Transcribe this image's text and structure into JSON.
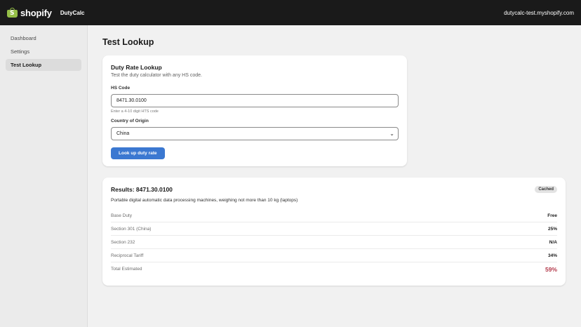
{
  "topbar": {
    "brand": "shopify",
    "app_name": "DutyCalc",
    "store": "dutycalc-test.myshopify.com"
  },
  "sidebar": {
    "items": [
      {
        "label": "Dashboard",
        "active": false
      },
      {
        "label": "Settings",
        "active": false
      },
      {
        "label": "Test Lookup",
        "active": true
      }
    ]
  },
  "page": {
    "title": "Test Lookup"
  },
  "lookup": {
    "title": "Duty Rate Lookup",
    "subtitle": "Test the duty calculator with any HS code.",
    "hs_label": "HS Code",
    "hs_value": "8471.30.0100",
    "hs_help": "Enter a 4-10 digit HTS code",
    "country_label": "Country of Origin",
    "country_value": "China",
    "button_label": "Look up duty rate"
  },
  "results": {
    "title": "Results: 8471.30.0100",
    "badge": "Cached",
    "description": "Portable digital automatic data processing machines, weighing not more than 10 kg (laptops)",
    "rows": [
      {
        "label": "Base Duty",
        "value": "Free"
      },
      {
        "label": "Section 301 (China)",
        "value": "25%"
      },
      {
        "label": "Section 232",
        "value": "N/A"
      },
      {
        "label": "Reciprocal Tariff",
        "value": "34%"
      },
      {
        "label": "Total Estimated",
        "value": "59%"
      }
    ]
  },
  "colors": {
    "topbar": "#1a1a1a",
    "brand_green": "#95bf47",
    "primary_button": "#3b78d1",
    "total_accent": "#b3384a"
  }
}
